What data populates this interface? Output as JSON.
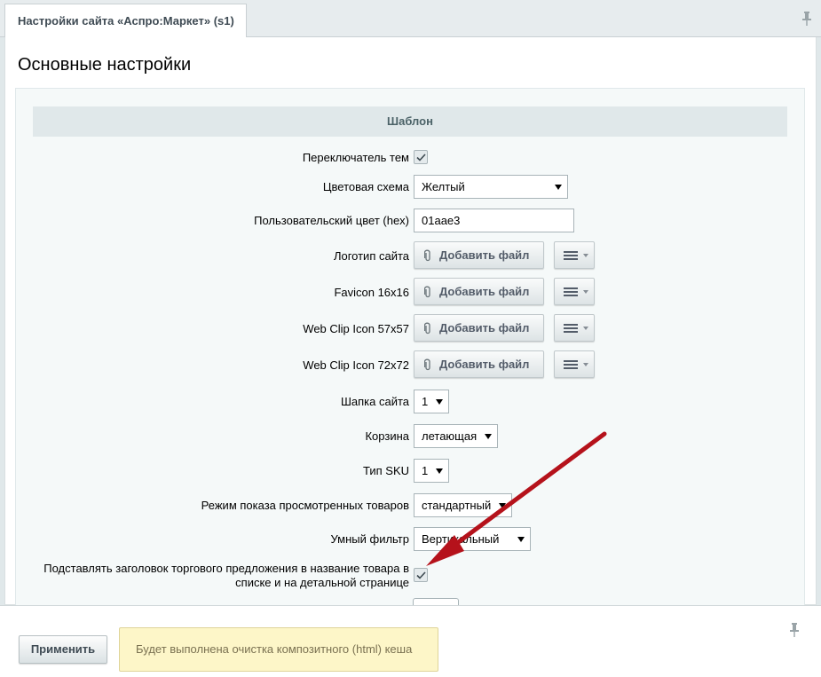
{
  "tab": {
    "label": "Настройки сайта «Аспро:Маркет» (s1)"
  },
  "page": {
    "title": "Основные настройки"
  },
  "section": {
    "title": "Шаблон"
  },
  "fields": {
    "theme_switcher": {
      "label": "Переключатель тем",
      "checked": true
    },
    "color_scheme": {
      "label": "Цветовая схема",
      "value": "Желтый"
    },
    "custom_color": {
      "label": "Пользовательский цвет (hex)",
      "value": "01aae3"
    },
    "logo": {
      "label": "Логотип сайта",
      "button": "Добавить файл"
    },
    "favicon": {
      "label": "Favicon 16x16",
      "button": "Добавить файл"
    },
    "webclip57": {
      "label": "Web Clip Icon 57x57",
      "button": "Добавить файл"
    },
    "webclip72": {
      "label": "Web Clip Icon 72x72",
      "button": "Добавить файл"
    },
    "header": {
      "label": "Шапка сайта",
      "value": "1"
    },
    "basket": {
      "label": "Корзина",
      "value": "летающая"
    },
    "sku_type": {
      "label": "Тип SKU",
      "value": "1"
    },
    "viewed_mode": {
      "label": "Режим показа просмотренных товаров",
      "value": "стандартный"
    },
    "smart_filter": {
      "label": "Умный фильтр",
      "value": "Вертикальный"
    },
    "offer_title": {
      "label_line1": "Подставлять заголовок торгового предложения в название товара в",
      "label_line2": "списке и на детальной странице",
      "checked": true
    }
  },
  "footer": {
    "apply_label": "Применить",
    "notice": "Будет выполнена очистка композитного (html) кеша"
  },
  "colors": {
    "background": "#e0e8ea",
    "section_header": "#e0e8ea",
    "notice_bg": "#fdf6c8",
    "annotation_arrow": "#b5121b"
  },
  "icons": [
    "pin-icon",
    "checkmark-icon",
    "paperclip-icon",
    "menu-icon",
    "dropdown-arrow-icon",
    "annotation-arrow"
  ]
}
